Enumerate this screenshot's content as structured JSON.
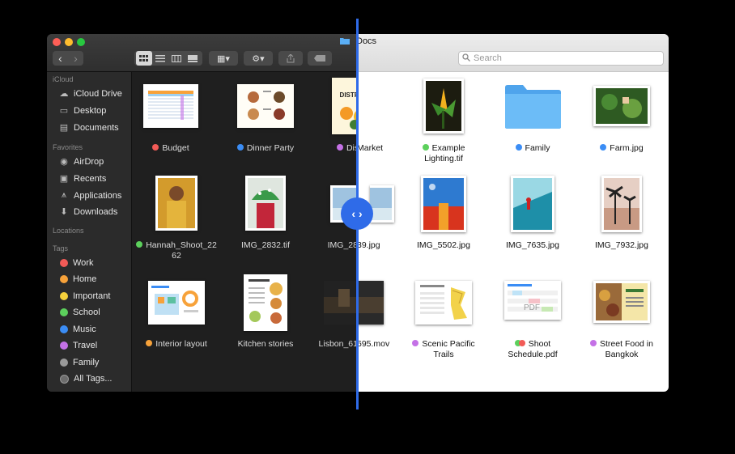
{
  "window": {
    "title": "Docs"
  },
  "toolbar": {
    "back": "‹",
    "forward": "›",
    "action_gear": "⚙▾",
    "group_menu": "▦▾"
  },
  "search": {
    "placeholder": "Search"
  },
  "sidebar": {
    "icloud_heading": "iCloud",
    "icloud": [
      {
        "label": "iCloud Drive",
        "icon": "cloud-icon"
      },
      {
        "label": "Desktop",
        "icon": "desktop-icon"
      },
      {
        "label": "Documents",
        "icon": "document-icon"
      }
    ],
    "favorites_heading": "Favorites",
    "favorites": [
      {
        "label": "AirDrop",
        "icon": "airdrop-icon"
      },
      {
        "label": "Recents",
        "icon": "clock-icon"
      },
      {
        "label": "Applications",
        "icon": "applications-icon"
      },
      {
        "label": "Downloads",
        "icon": "download-icon"
      }
    ],
    "locations_heading": "Locations",
    "tags_heading": "Tags",
    "tags": [
      {
        "label": "Work",
        "color": "#f25b57"
      },
      {
        "label": "Home",
        "color": "#f7a23a"
      },
      {
        "label": "Important",
        "color": "#f5d13c"
      },
      {
        "label": "School",
        "color": "#5cd05c"
      },
      {
        "label": "Music",
        "color": "#3b8df5"
      },
      {
        "label": "Travel",
        "color": "#c471e6"
      },
      {
        "label": "Family",
        "color": "#9a9a9a"
      },
      {
        "label": "All Tags...",
        "color": "#6d6d6d"
      }
    ]
  },
  "files": [
    {
      "name": "Budget",
      "tag": "#f25b57"
    },
    {
      "name": "Dinner Party",
      "tag": "#3b8df5"
    },
    {
      "name": "District Market",
      "tag": "#c471e6"
    },
    {
      "name": "Example Lighting.tif",
      "tag": "#5cd05c"
    },
    {
      "name": "Family",
      "tag": "#3b8df5"
    },
    {
      "name": "Farm.jpg",
      "tag": "#3b8df5"
    },
    {
      "name": "Hannah_Shoot_2262",
      "tag": "#5cd05c"
    },
    {
      "name": "IMG_2832.tif",
      "tag": ""
    },
    {
      "name": "IMG_2839.jpg",
      "tag": ""
    },
    {
      "name": "IMG_5502.jpg",
      "tag": ""
    },
    {
      "name": "IMG_7635.jpg",
      "tag": ""
    },
    {
      "name": "IMG_7932.jpg",
      "tag": ""
    },
    {
      "name": "Interior layout",
      "tag": "#f7a23a"
    },
    {
      "name": "Kitchen stories",
      "tag": ""
    },
    {
      "name": "Lisbon_61695.mov",
      "tag": ""
    },
    {
      "name": "Scenic Pacific Trails",
      "tag": "#c471e6"
    },
    {
      "name": "Shoot Schedule.pdf",
      "tag": "#5cd05c,#f25b57"
    },
    {
      "name": "Street Food in Bangkok",
      "tag": "#c471e6"
    }
  ],
  "labels": {
    "f0": "Budget",
    "f1": "Dinner Party",
    "f2a": "District",
    "f2b": "Market",
    "f3a": "Example",
    "f3b": "Lighting.tif",
    "f4": "Family",
    "f5": "Farm.jpg",
    "f6a": "Hannah_Shoot_22",
    "f6b": "62",
    "f7": "IMG_2832.tif",
    "f8a": "IMG_28",
    "f8b": "39.jpg",
    "f9": "IMG_5502.jpg",
    "f10": "IMG_7635.jpg",
    "f11": "IMG_7932.jpg",
    "f12": "Interior layout",
    "f13": "Kitchen stories",
    "f14a": "Lisbon_61",
    "f14b": "695.mov",
    "f15a": "Scenic Pacific",
    "f15b": "Trails",
    "f16a": "Shoot",
    "f16b": "Schedule.pdf",
    "f17a": "Street Food in",
    "f17b": "Bangkok"
  },
  "thumb_text": {
    "district": "DISTRICT",
    "pdf": "PDF"
  },
  "compare_handle": "‹ ›"
}
